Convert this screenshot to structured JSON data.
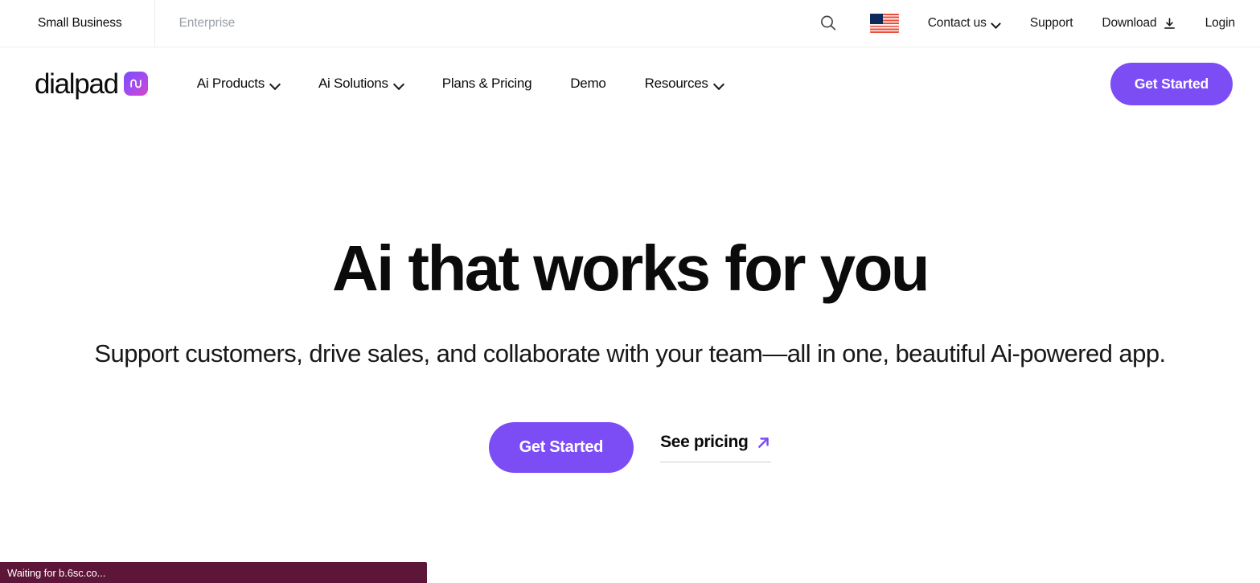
{
  "topbar": {
    "segments": [
      {
        "label": "Small Business",
        "active": true
      },
      {
        "label": "Enterprise",
        "active": false
      }
    ],
    "search_icon": "search-icon",
    "locale_flag": "us-flag-icon",
    "links": [
      {
        "label": "Contact us",
        "has_chevron": true
      },
      {
        "label": "Support",
        "has_chevron": false
      },
      {
        "label": "Download",
        "has_chevron": false,
        "icon": "download-icon"
      },
      {
        "label": "Login",
        "has_chevron": false
      }
    ]
  },
  "mainnav": {
    "logo_text": "dialpad",
    "logo_badge_icon": "ai-badge-icon",
    "items": [
      {
        "label": "Ai Products",
        "has_chevron": true
      },
      {
        "label": "Ai Solutions",
        "has_chevron": true
      },
      {
        "label": "Plans & Pricing",
        "has_chevron": false
      },
      {
        "label": "Demo",
        "has_chevron": false
      },
      {
        "label": "Resources",
        "has_chevron": true
      }
    ],
    "cta_label": "Get Started"
  },
  "hero": {
    "title": "Ai that works for you",
    "subtitle": "Support customers, drive sales, and collaborate with your team—all in one, beautiful Ai-powered app.",
    "primary_cta": "Get Started",
    "secondary_cta": "See pricing",
    "secondary_cta_icon": "arrow-up-right-icon"
  },
  "browser": {
    "status_text": "Waiting for b.6sc.co..."
  },
  "colors": {
    "accent_purple": "#7C4DF5",
    "badge_gradient_start": "#7B4DF5",
    "badge_gradient_end": "#D946C8",
    "text_primary": "#0b0b0c",
    "text_muted": "#9aa0a6",
    "status_bar_bg": "#5E1638",
    "flag_red": "#e8503c",
    "flag_navy": "#0d2a5c"
  }
}
